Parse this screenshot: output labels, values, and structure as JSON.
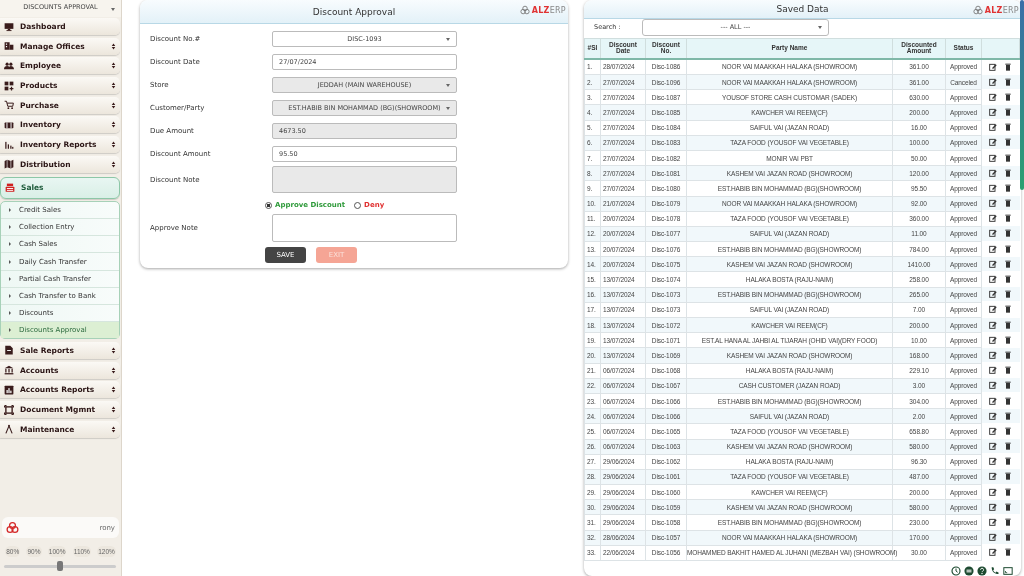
{
  "sidebar": {
    "title": "DISCOUNTS APPROVAL",
    "items": [
      {
        "label": "Dashboard"
      },
      {
        "label": "Manage Offices",
        "expanded": false
      },
      {
        "label": "Employee",
        "expanded": false
      },
      {
        "label": "Products",
        "expanded": false
      },
      {
        "label": "Purchase",
        "expanded": false
      },
      {
        "label": "Inventory",
        "expanded": false
      },
      {
        "label": "Inventory Reports",
        "expanded": false
      },
      {
        "label": "Distribution",
        "expanded": false
      },
      {
        "label": "Sales",
        "expanded": true,
        "children": [
          {
            "label": "Credit Sales",
            "selected": false
          },
          {
            "label": "Collection Entry",
            "selected": false
          },
          {
            "label": "Cash Sales",
            "selected": false
          },
          {
            "label": "Daily Cash Transfer",
            "selected": false
          },
          {
            "label": "Partial Cash Transfer",
            "selected": false
          },
          {
            "label": "Cash Transfer to Bank",
            "selected": false
          },
          {
            "label": "Discounts",
            "selected": false
          },
          {
            "label": "Discounts Approval",
            "selected": true
          }
        ]
      },
      {
        "label": "Sale Reports",
        "expanded": false
      },
      {
        "label": "Accounts",
        "expanded": false
      },
      {
        "label": "Accounts Reports",
        "expanded": false
      },
      {
        "label": "Document Mgmnt",
        "expanded": false
      },
      {
        "label": "Maintenance",
        "expanded": false
      }
    ],
    "user": "rony",
    "zoom": {
      "labels": [
        "80%",
        "90%",
        "100%",
        "110%",
        "120%"
      ],
      "level": 0.5
    }
  },
  "form": {
    "title": "Discount Approval",
    "logo": [
      "ALZ",
      "ERP"
    ],
    "fields": [
      {
        "label": "Discount No.#",
        "kind": "select",
        "value": "DISC-1093",
        "disabled": false
      },
      {
        "label": "Discount Date",
        "kind": "input",
        "value": "27/07/2024",
        "disabled": false
      },
      {
        "label": "Store",
        "kind": "select",
        "value": "JEDDAH (MAIN WAREHOUSE)",
        "disabled": true
      },
      {
        "label": "Customer/Party",
        "kind": "select",
        "value": "EST.HABIB BIN MOHAMMAD (BG)(SHOWROOM)",
        "disabled": true
      },
      {
        "label": "Due Amount",
        "kind": "input",
        "value": "4673.50",
        "disabled": true
      },
      {
        "label": "Discount Amount",
        "kind": "input",
        "value": "95.50",
        "disabled": false
      },
      {
        "label": "Discount Note",
        "kind": "textarea",
        "disabled": true
      }
    ],
    "decision": [
      {
        "label": "Approve Discount",
        "selected": true,
        "color": "#2e9a3a"
      },
      {
        "label": "Deny",
        "selected": false,
        "color": "#e03030"
      }
    ],
    "approve_note": {
      "label": "Approve Note"
    },
    "buttons": [
      {
        "label": "SAVE",
        "disabled": false
      },
      {
        "label": "EXIT",
        "disabled": true
      }
    ]
  },
  "saved": {
    "title": "Saved Data",
    "logo": [
      "ALZ",
      "ERP"
    ],
    "search": {
      "label": "Search :",
      "value": "--- ALL ---"
    },
    "columns": [
      "#Sl",
      "Discount Date",
      "Discount No.",
      "Party Name",
      "Discounted Amount",
      "Status"
    ],
    "rows": [
      [
        "1.",
        "28/07/2024",
        "Disc-1086",
        "NOOR VAI MAAKKAH HALAKA (SHOWROOM)",
        "361.00",
        "Approved"
      ],
      [
        "2.",
        "27/07/2024",
        "Disc-1096",
        "NOOR VAI MAAKKAH HALAKA (SHOWROOM)",
        "361.00",
        "Canceled"
      ],
      [
        "3.",
        "27/07/2024",
        "Disc-1087",
        "YOUSOF STORE CASH CUSTOMAR (SADEK)",
        "630.00",
        "Approved"
      ],
      [
        "4.",
        "27/07/2024",
        "Disc-1085",
        "KAWCHER VAI REEM(CF)",
        "200.00",
        "Approved"
      ],
      [
        "5.",
        "27/07/2024",
        "Disc-1084",
        "SAIFUL VAI (JAZAN ROAD)",
        "16.00",
        "Approved"
      ],
      [
        "6.",
        "27/07/2024",
        "Disc-1083",
        "TAZA FOOD (YOUSOF VAI VEGETABLE)",
        "100.00",
        "Approved"
      ],
      [
        "7.",
        "27/07/2024",
        "Disc-1082",
        "MONIR VAI PBT",
        "50.00",
        "Approved"
      ],
      [
        "8.",
        "27/07/2024",
        "Disc-1081",
        "KASHEM VAI JAZAN ROAD (SHOWROOM)",
        "120.00",
        "Approved"
      ],
      [
        "9.",
        "27/07/2024",
        "Disc-1080",
        "EST.HABIB BIN MOHAMMAD (BG)(SHOWROOM)",
        "95.50",
        "Approved"
      ],
      [
        "10.",
        "21/07/2024",
        "Disc-1079",
        "NOOR VAI MAAKKAH HALAKA (SHOWROOM)",
        "92.00",
        "Approved"
      ],
      [
        "11.",
        "20/07/2024",
        "Disc-1078",
        "TAZA FOOD (YOUSOF VAI VEGETABLE)",
        "360.00",
        "Approved"
      ],
      [
        "12.",
        "20/07/2024",
        "Disc-1077",
        "SAIFUL VAI (JAZAN ROAD)",
        "11.00",
        "Approved"
      ],
      [
        "13.",
        "20/07/2024",
        "Disc-1076",
        "EST.HABIB BIN MOHAMMAD (BG)(SHOWROOM)",
        "784.00",
        "Approved"
      ],
      [
        "14.",
        "20/07/2024",
        "Disc-1075",
        "KASHEM VAI JAZAN ROAD (SHOWROOM)",
        "1410.00",
        "Approved"
      ],
      [
        "15.",
        "13/07/2024",
        "Disc-1074",
        "HALAKA BOSTA (RAJU-NAIM)",
        "258.00",
        "Approved"
      ],
      [
        "16.",
        "13/07/2024",
        "Disc-1073",
        "EST.HABIB BIN MOHAMMAD (BG)(SHOWROOM)",
        "265.00",
        "Approved"
      ],
      [
        "17.",
        "13/07/2024",
        "Disc-1073",
        "SAIFUL VAI (JAZAN ROAD)",
        "7.00",
        "Approved"
      ],
      [
        "18.",
        "13/07/2024",
        "Disc-1072",
        "KAWCHER VAI REEM(CF)",
        "200.00",
        "Approved"
      ],
      [
        "19.",
        "13/07/2024",
        "Disc-1071",
        "EST.AL HANA AL JAHBI AL TIJARAH (OHID VAI)(DRY FOOD)",
        "10.00",
        "Approved"
      ],
      [
        "20.",
        "13/07/2024",
        "Disc-1069",
        "KASHEM VAI JAZAN ROAD (SHOWROOM)",
        "168.00",
        "Approved"
      ],
      [
        "21.",
        "06/07/2024",
        "Disc-1068",
        "HALAKA BOSTA (RAJU-NAIM)",
        "229.10",
        "Approved"
      ],
      [
        "22.",
        "06/07/2024",
        "Disc-1067",
        "CASH CUSTOMER (JAZAN ROAD)",
        "3.00",
        "Approved"
      ],
      [
        "23.",
        "06/07/2024",
        "Disc-1066",
        "EST.HABIB BIN MOHAMMAD (BG)(SHOWROOM)",
        "304.00",
        "Approved"
      ],
      [
        "24.",
        "06/07/2024",
        "Disc-1066",
        "SAIFUL VAI (JAZAN ROAD)",
        "2.00",
        "Approved"
      ],
      [
        "25.",
        "06/07/2024",
        "Disc-1065",
        "TAZA FOOD (YOUSOF VAI VEGETABLE)",
        "658.80",
        "Approved"
      ],
      [
        "26.",
        "06/07/2024",
        "Disc-1063",
        "KASHEM VAI JAZAN ROAD (SHOWROOM)",
        "580.00",
        "Approved"
      ],
      [
        "27.",
        "29/06/2024",
        "Disc-1062",
        "HALAKA BOSTA (RAJU-NAIM)",
        "96.30",
        "Approved"
      ],
      [
        "28.",
        "29/06/2024",
        "Disc-1061",
        "TAZA FOOD (YOUSOF VAI VEGETABLE)",
        "487.00",
        "Approved"
      ],
      [
        "29.",
        "29/06/2024",
        "Disc-1060",
        "KAWCHER VAI REEM(CF)",
        "200.00",
        "Approved"
      ],
      [
        "30.",
        "29/06/2024",
        "Disc-1059",
        "KASHEM VAI JAZAN ROAD (SHOWROOM)",
        "580.00",
        "Approved"
      ],
      [
        "31.",
        "29/06/2024",
        "Disc-1058",
        "EST.HABIB BIN MOHAMMAD (BG)(SHOWROOM)",
        "230.00",
        "Approved"
      ],
      [
        "32.",
        "28/06/2024",
        "Disc-1057",
        "NOOR VAI MAAKKAH HALAKA (SHOWROOM)",
        "170.00",
        "Approved"
      ],
      [
        "33.",
        "22/06/2024",
        "Disc-1056",
        "MOHAMMED BAKHIT HAMED AL JUHANI (MEZBAH VAI) (SHOWROOM)",
        "30.00",
        "Approved"
      ]
    ]
  }
}
